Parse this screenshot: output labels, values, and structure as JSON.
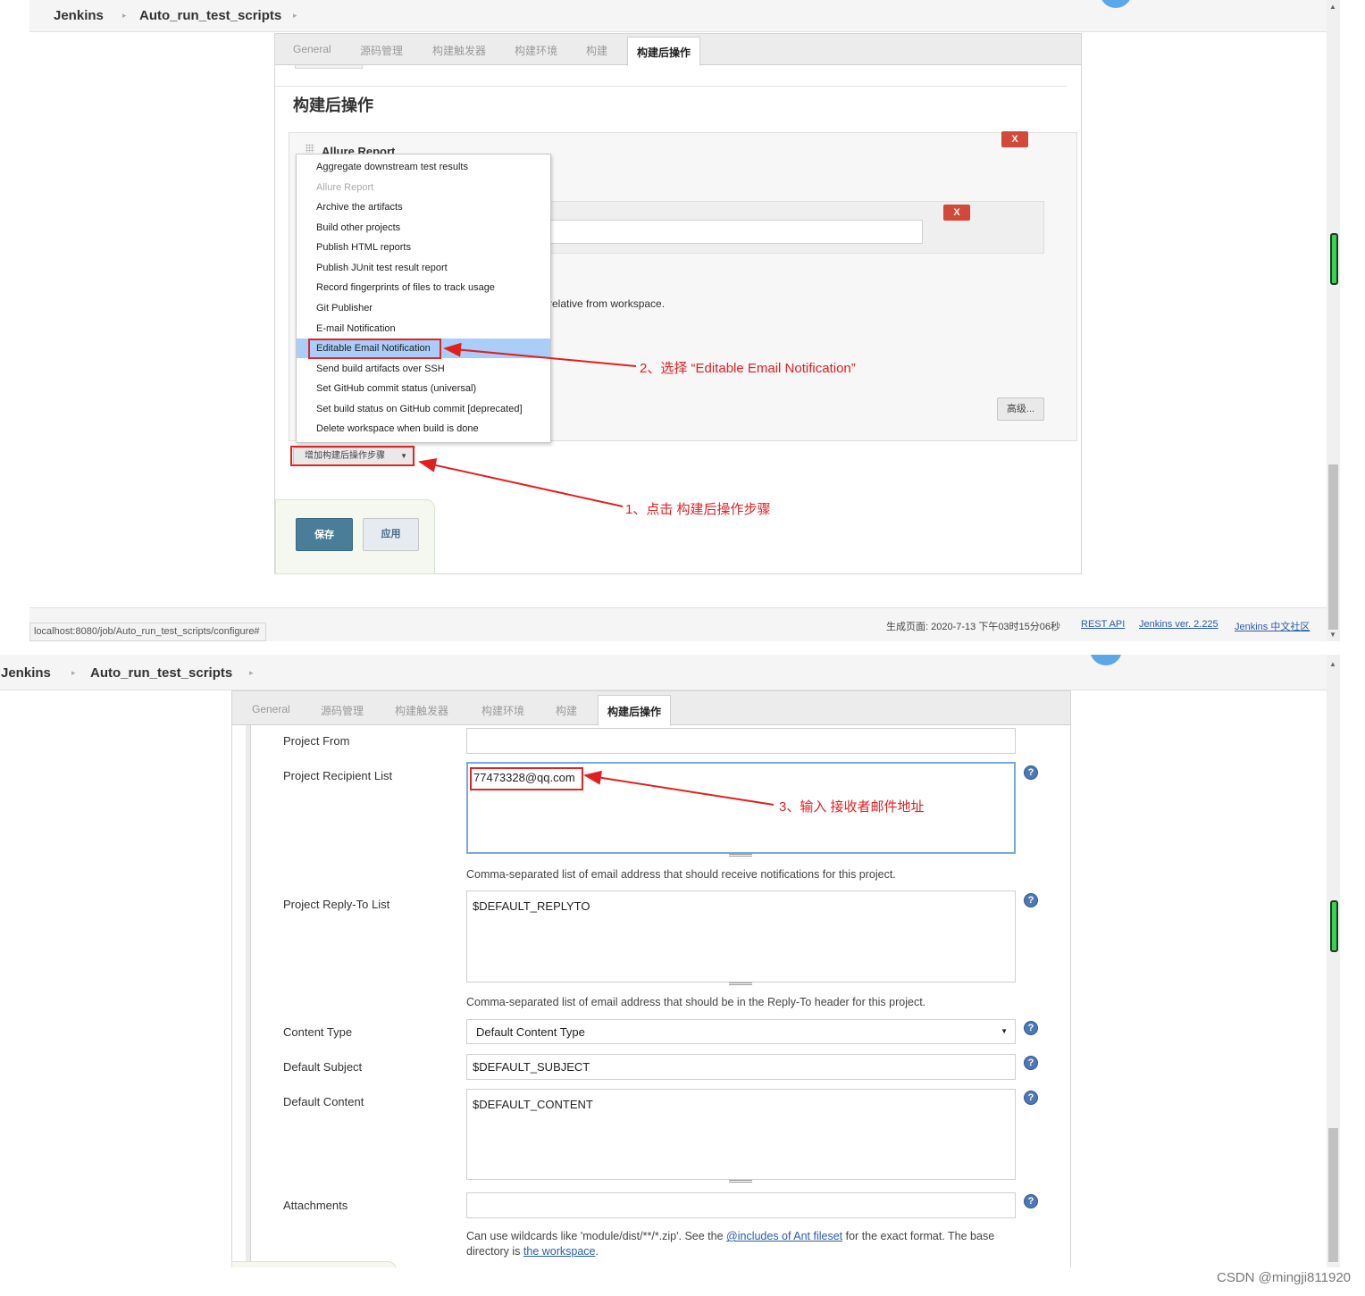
{
  "breadcrumb": {
    "root": "Jenkins",
    "job": "Auto_run_test_scripts"
  },
  "tabs": [
    "General",
    "源码管理",
    "构建触发器",
    "构建环境",
    "构建",
    "构建后操作"
  ],
  "screen1": {
    "section_title": "构建后操作",
    "allure_title": "Allure Report",
    "delete_label": "X",
    "relative_text": "relative from workspace.",
    "advanced_button": "高级...",
    "add_step_button": "增加构建后操作步骤",
    "menu_items": [
      {
        "label": "Aggregate downstream test results",
        "disabled": false
      },
      {
        "label": "Allure Report",
        "disabled": true
      },
      {
        "label": "Archive the artifacts",
        "disabled": false
      },
      {
        "label": "Build other projects",
        "disabled": false
      },
      {
        "label": "Publish HTML reports",
        "disabled": false
      },
      {
        "label": "Publish JUnit test result report",
        "disabled": false
      },
      {
        "label": "Record fingerprints of files to track usage",
        "disabled": false
      },
      {
        "label": "Git Publisher",
        "disabled": false
      },
      {
        "label": "E-mail Notification",
        "disabled": false
      },
      {
        "label": "Editable Email Notification",
        "disabled": false,
        "highlighted": true
      },
      {
        "label": "Send build artifacts over SSH",
        "disabled": false
      },
      {
        "label": "Set GitHub commit status (universal)",
        "disabled": false
      },
      {
        "label": "Set build status on GitHub commit [deprecated]",
        "disabled": false
      },
      {
        "label": "Delete workspace when build is done",
        "disabled": false
      }
    ],
    "save_button": "保存",
    "apply_button": "应用",
    "annotation_1": "1、点击 构建后操作步骤",
    "annotation_2": "2、选择 “Editable Email Notification”",
    "footer": {
      "generated": "生成页面: 2020-7-13 下午03时15分06秒",
      "rest_api": "REST API",
      "version": "Jenkins ver. 2.225",
      "community": "Jenkins 中文社区"
    },
    "status_url": "localhost:8080/job/Auto_run_test_scripts/configure#"
  },
  "screen2": {
    "fields": {
      "project_from": {
        "label": "Project From",
        "value": ""
      },
      "recipient_list": {
        "label": "Project Recipient List",
        "value": "77473328@qq.com",
        "description": "Comma-separated list of email address that should receive notifications for this project."
      },
      "reply_to": {
        "label": "Project Reply-To List",
        "value": "$DEFAULT_REPLYTO",
        "description": "Comma-separated list of email address that should be in the Reply-To header for this project."
      },
      "content_type": {
        "label": "Content Type",
        "value": "Default Content Type"
      },
      "default_subject": {
        "label": "Default Subject",
        "value": "$DEFAULT_SUBJECT"
      },
      "default_content": {
        "label": "Default Content",
        "value": "$DEFAULT_CONTENT"
      },
      "attachments": {
        "label": "Attachments",
        "value": "",
        "desc_part1": "Can use wildcards like 'module/dist/**/*.zip'. See the ",
        "desc_link1": "@includes of Ant fileset",
        "desc_part2": " for the exact format. The base directory is ",
        "desc_link2": "the workspace",
        "desc_part3": "."
      }
    },
    "help_icon": "?",
    "annotation_3": "3、输入 接收者邮件地址"
  },
  "watermark": "CSDN @mingji811920",
  "colors": {
    "annotation_red": "#e02020",
    "delete_red": "#d24939",
    "save_blue": "#4a7d97",
    "menu_highlight": "#aacdfa",
    "help_blue": "#4d78b3",
    "scroll_green": "#38d34e"
  }
}
